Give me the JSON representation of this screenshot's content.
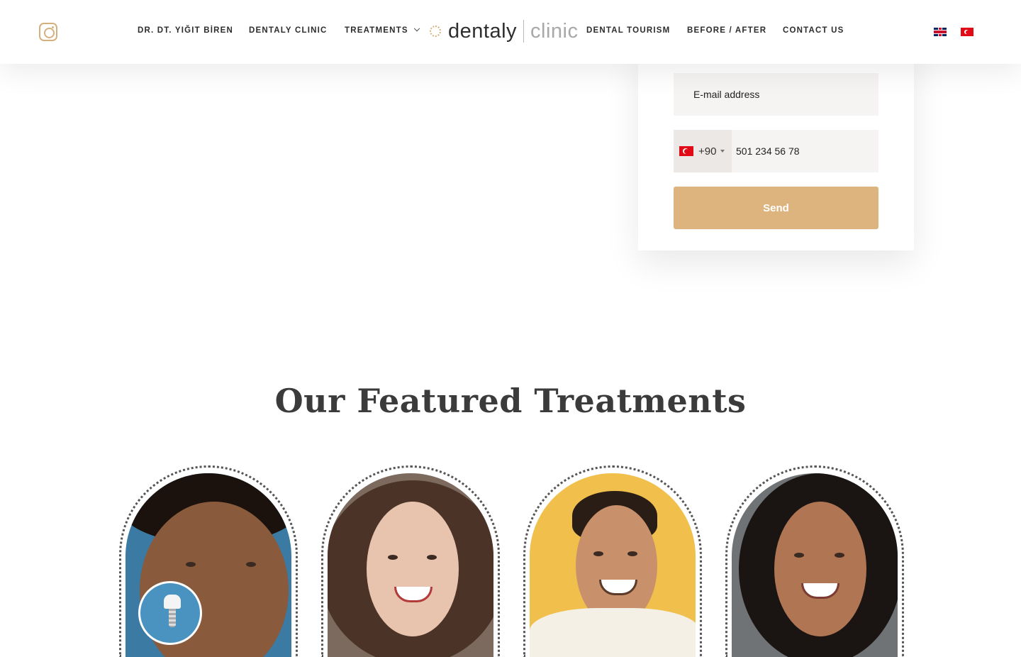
{
  "header": {
    "nav_left": [
      "DR. DT. YIĞIT BİREN",
      "DENTALY CLINIC",
      "TREATMENTS"
    ],
    "nav_right": [
      "DENTAL TOURISM",
      "BEFORE / AFTER",
      "CONTACT US"
    ],
    "logo": {
      "primary": "dentaly",
      "secondary": "clinic"
    },
    "languages": [
      "English",
      "Türkçe"
    ]
  },
  "form": {
    "email_placeholder": "E-mail address",
    "dial_code": "+90",
    "phone_placeholder": "501 234 56 78",
    "send_label": "Send"
  },
  "featured": {
    "title": "Our Featured Treatments",
    "cards": [
      {
        "icon": "dental-implant-icon"
      },
      {
        "icon": ""
      },
      {
        "icon": ""
      },
      {
        "icon": ""
      }
    ]
  },
  "colors": {
    "accent": "#ddb47e",
    "text": "#2c2c2c",
    "input_bg": "#f6f4f2"
  }
}
